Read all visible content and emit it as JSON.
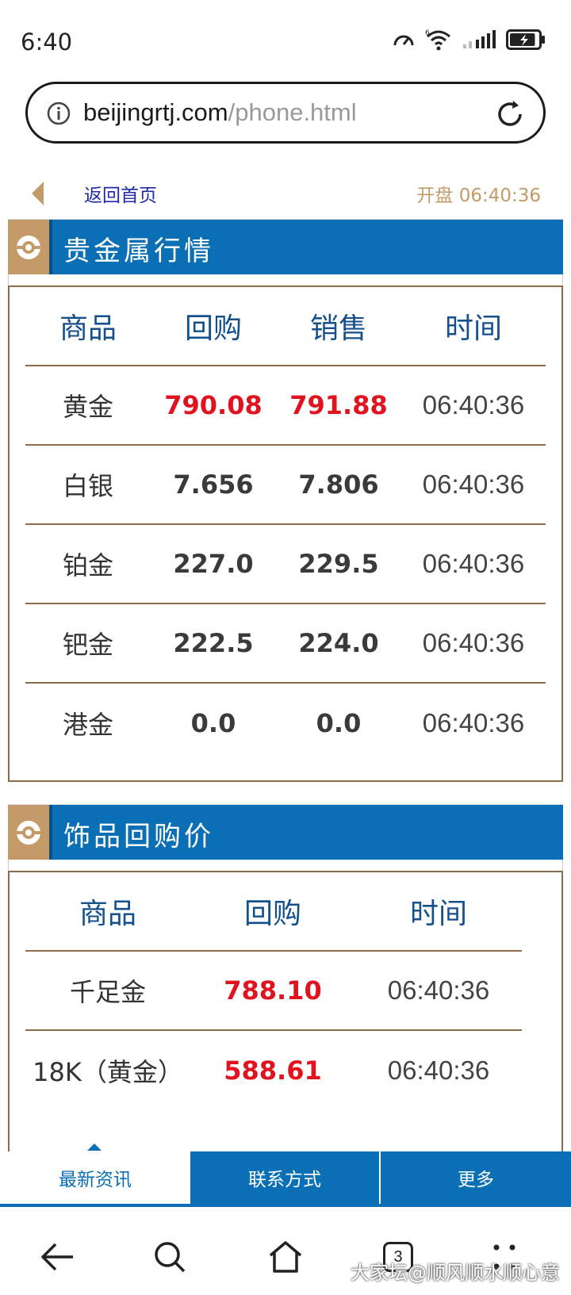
{
  "status_bar": {
    "time": "6:40",
    "wifi_label": "6",
    "battery_level": 0.9
  },
  "browser": {
    "url_domain": "beijingrtj.com",
    "url_path": "/phone.html"
  },
  "nav": {
    "home_link": "返回首页",
    "open_label": "开盘 06:40:36"
  },
  "precious_metals": {
    "title": "贵金属行情",
    "headers": [
      "商品",
      "回购",
      "销售",
      "时间"
    ],
    "rows": [
      {
        "name": "黄金",
        "buyback": "790.08",
        "sale": "791.88",
        "time": "06:40:36",
        "highlight": true
      },
      {
        "name": "白银",
        "buyback": "7.656",
        "sale": "7.806",
        "time": "06:40:36",
        "highlight": false
      },
      {
        "name": "铂金",
        "buyback": "227.0",
        "sale": "229.5",
        "time": "06:40:36",
        "highlight": false
      },
      {
        "name": "钯金",
        "buyback": "222.5",
        "sale": "224.0",
        "time": "06:40:36",
        "highlight": false
      },
      {
        "name": "港金",
        "buyback": "0.0",
        "sale": "0.0",
        "time": "06:40:36",
        "highlight": false
      }
    ]
  },
  "jewelry_buyback": {
    "title": "饰品回购价",
    "headers": [
      "商品",
      "回购",
      "时间"
    ],
    "rows": [
      {
        "name": "千足金",
        "buyback": "788.10",
        "time": "06:40:36"
      },
      {
        "name": "18K（黄金）",
        "buyback": "588.61",
        "time": "06:40:36"
      }
    ]
  },
  "bottom_tabs": {
    "news": "最新资讯",
    "contact": "联系方式",
    "more": "更多"
  },
  "system_nav": {
    "tab_count": "3"
  },
  "watermark": "大家坛@顺风顺水顺心意",
  "colors": {
    "primary_blue": "#0b6fb5",
    "gold": "#c49a68",
    "price_red": "#e0131e",
    "header_text": "#14508c"
  }
}
